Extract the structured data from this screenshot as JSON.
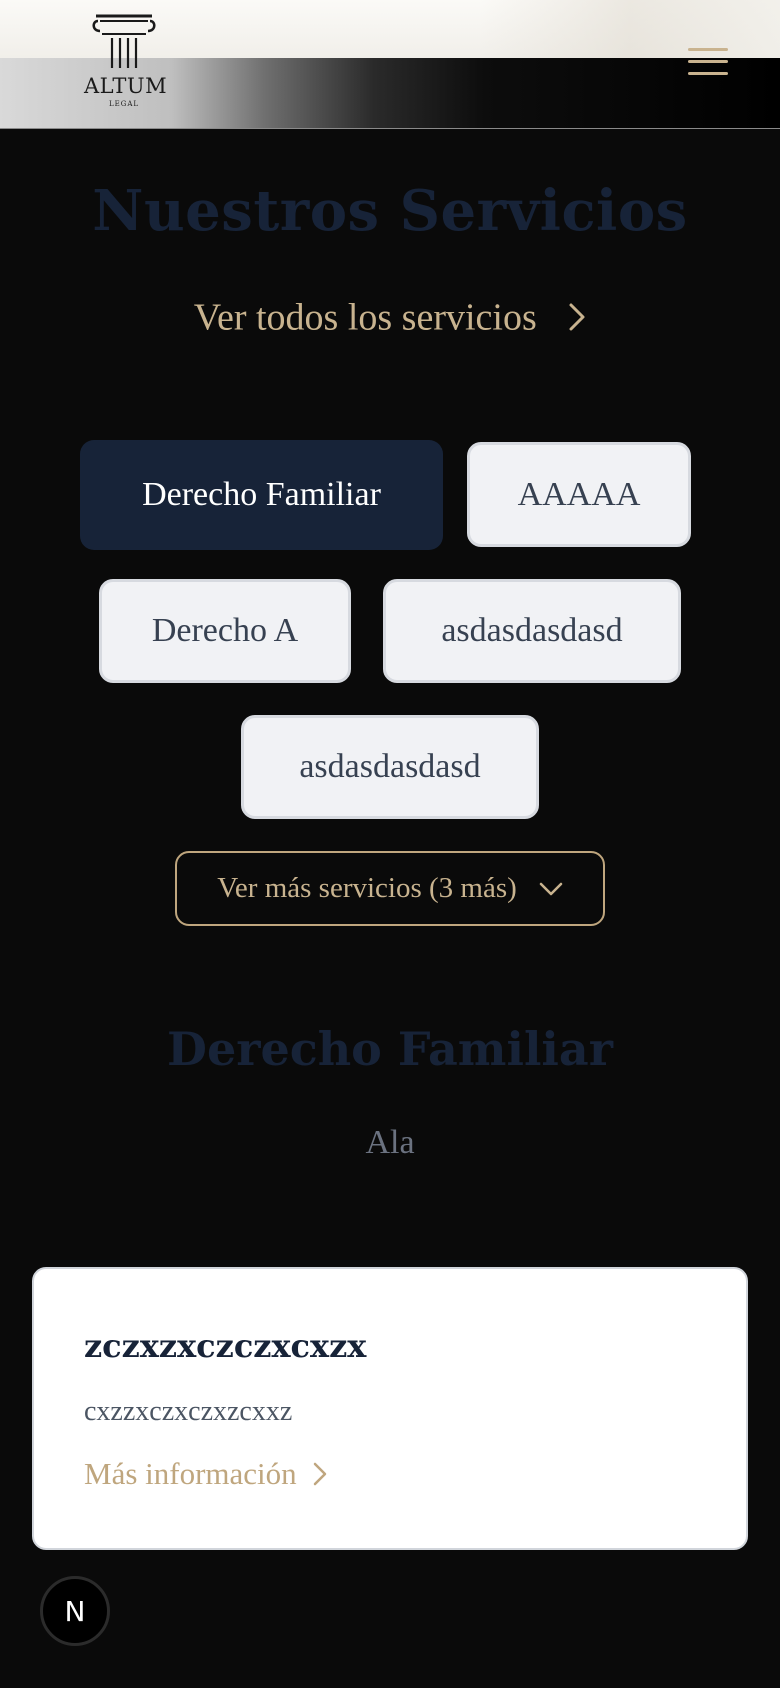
{
  "header": {
    "logo_text": "ALTUM",
    "logo_subtext": "LEGAL",
    "menu_icon": "hamburger-menu-icon"
  },
  "services": {
    "title": "Nuestros Servicios",
    "view_all_label": "Ver todos los servicios",
    "chips": [
      {
        "label": "Derecho Familiar",
        "active": true
      },
      {
        "label": "AAAAA",
        "active": false
      },
      {
        "label": "Derecho A",
        "active": false
      },
      {
        "label": "asdasdasdasd",
        "active": false
      },
      {
        "label": "asdasdasdasd",
        "active": false
      }
    ],
    "more_button_label": "Ver más servicios (3 más)"
  },
  "category": {
    "title": "Derecho Familiar",
    "description": "Ala"
  },
  "card": {
    "title": "zczxzxczczxcxzx",
    "text": "cxzzxczxczxzcxxz",
    "link_label": "Más información"
  },
  "fab": {
    "label": "N"
  },
  "colors": {
    "page_background": "#0a0a0a",
    "navy": "#172338",
    "gold": "#c8b38f",
    "chip_background": "#f1f2f5"
  }
}
